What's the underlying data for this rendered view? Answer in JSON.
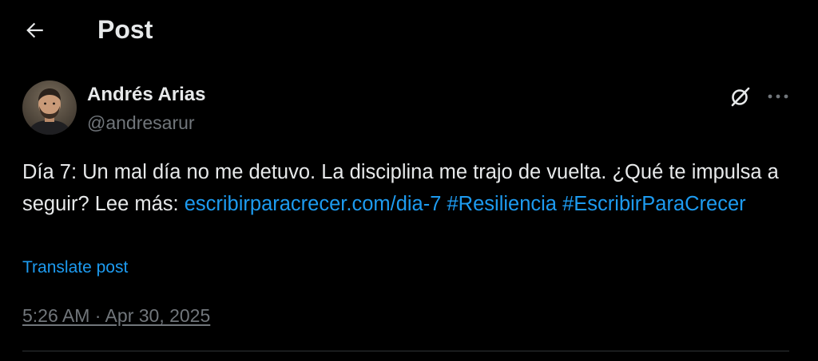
{
  "header": {
    "title": "Post",
    "back_icon": "arrow-left-icon"
  },
  "author": {
    "name": "Andrés Arias",
    "handle": "@andresarur",
    "avatar_icon": "avatar-photo"
  },
  "actions": {
    "grok_icon": "grok-icon",
    "more_icon": "more-horizontal-icon"
  },
  "post": {
    "text_part1": "Día 7: Un mal día no me detuvo. La disciplina me trajo de vuelta. ¿Qué te impulsa a seguir? Lee más: ",
    "link": "escribirparacrecer.com/dia-7",
    "hashtag1": "#Resiliencia",
    "hashtag2": "#EscribirParaCrecer"
  },
  "translate_label": "Translate post",
  "timestamp": "5:26 AM · Apr 30, 2025",
  "colors": {
    "background": "#000000",
    "primary_text": "#e7e9ea",
    "secondary_text": "#71767b",
    "accent": "#1d9bf0",
    "divider": "#2f3336"
  }
}
